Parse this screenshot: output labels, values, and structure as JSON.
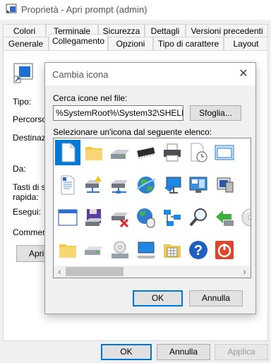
{
  "window": {
    "title": "Proprietà - Apri prompt (admin)",
    "tabs_row1": [
      "Colori",
      "Terminale",
      "Sicurezza",
      "Dettagli",
      "Versioni precedenti"
    ],
    "tabs_row2": [
      "Generale",
      "Collegamento",
      "Opzioni",
      "Tipo di carattere",
      "Layout"
    ],
    "active_tab": "Collegamento"
  },
  "shortcut_panel": {
    "labels": {
      "type": "Tipo:",
      "path": "Percorso:",
      "destination": "Destinazio",
      "from": "Da:",
      "hotkey_line1": "Tasti di sc",
      "hotkey_line2": "rapida:",
      "run": "Esegui:",
      "comment": "Commento"
    },
    "open_button_label": "Apri p"
  },
  "buttons": {
    "ok": "OK",
    "cancel": "Annulla",
    "apply": "Applica"
  },
  "icon_dialog": {
    "title": "Cambia icona",
    "file_label": "Cerca icone nel file:",
    "file_value": "%SystemRoot%\\System32\\SHELL32.dll",
    "browse_label": "Sfoglia...",
    "list_label": "Selezionare un'icona dal seguente elenco:",
    "ok_label": "OK",
    "cancel_label": "Annulla",
    "icons": [
      "blank-document-icon",
      "folder-icon",
      "disk-drive-icon",
      "memory-chip-icon",
      "printer-icon",
      "clock-document-icon",
      "window-icon",
      "partial-icon",
      "text-document-icon",
      "network-drive-icon",
      "network-server-icon",
      "globe-icon",
      "network-monitor-icon",
      "control-panel-icon",
      "monitor-icon",
      "shortcut-icon",
      "application-window-icon",
      "floppy-disk-icon",
      "disconnected-drive-icon",
      "globe-mouse-icon",
      "network-icon",
      "magnifier-icon",
      "restore-arrow-icon",
      "cd-icon",
      "folder-icon",
      "drive-icon",
      "cd-drive-icon",
      "computer-icon",
      "folder-grid-icon",
      "help-icon",
      "power-icon",
      "partial-icon"
    ],
    "selected_icon": 0
  }
}
